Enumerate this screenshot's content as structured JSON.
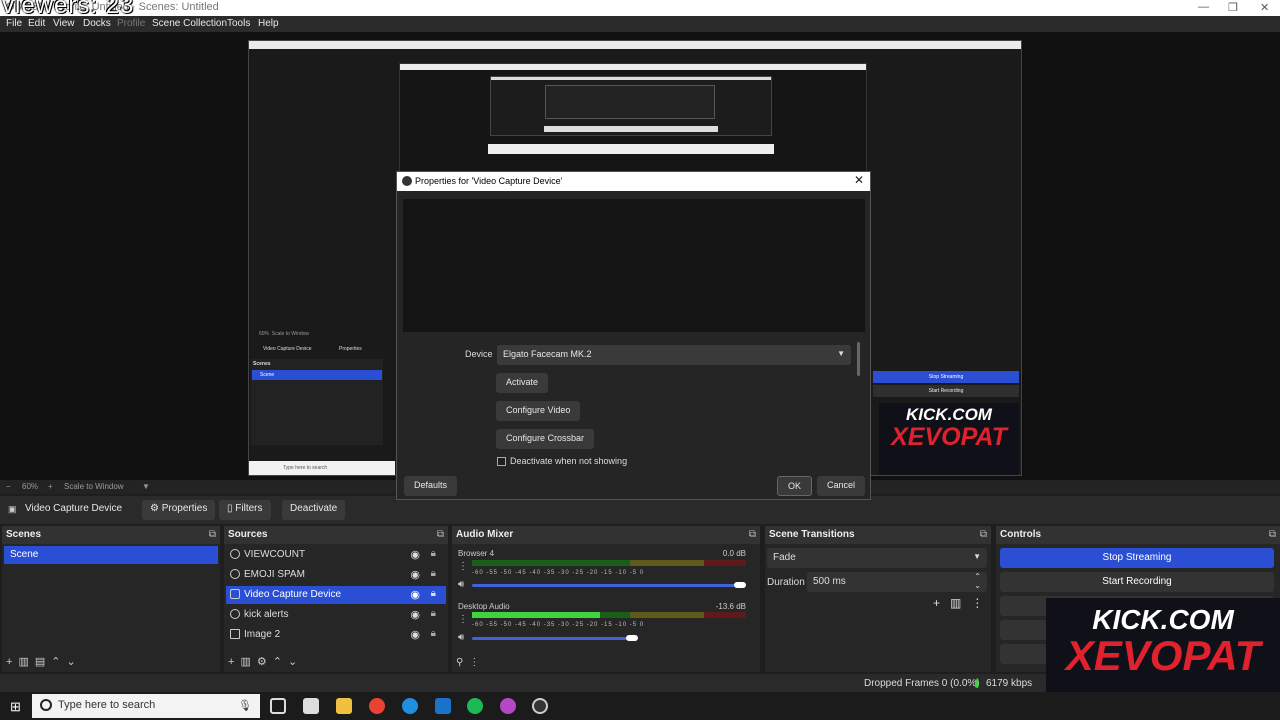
{
  "titlebar": {
    "title": "OBS 32 · Profile: Untitled · Scenes: Untitled",
    "overlay": "viewers: 23"
  },
  "menu": {
    "items": [
      "File",
      "Edit",
      "View",
      "Docks",
      "Profile",
      "Scene Collection",
      "Tools",
      "Help"
    ]
  },
  "zoombar": {
    "zoom": "60%",
    "scale": "Scale to Window"
  },
  "context": {
    "source": "Video Capture Device",
    "properties": "Properties",
    "filters": "Filters",
    "deactivate": "Deactivate"
  },
  "scenes": {
    "title": "Scenes",
    "items": [
      "Scene"
    ]
  },
  "sources": {
    "title": "Sources",
    "items": [
      "VIEWCOUNT",
      "EMOJI SPAM",
      "Video Capture Device",
      "kick alerts",
      "Image 2"
    ]
  },
  "mixer": {
    "title": "Audio Mixer",
    "channels": [
      {
        "name": "Browser 4",
        "db": "0.0 dB",
        "level": 0.0
      },
      {
        "name": "Desktop Audio",
        "db": "-13.6 dB",
        "level": 0.45
      }
    ],
    "scale": "-60 -55 -50 -45 -40 -35 -30 -25 -20 -15 -10 -5 0"
  },
  "transitions": {
    "title": "Scene Transitions",
    "selected": "Fade",
    "duration_label": "Duration",
    "duration": "500 ms"
  },
  "controls": {
    "title": "Controls",
    "stop_streaming": "Stop Streaming",
    "start_recording": "Start Recording"
  },
  "status": {
    "dropped": "Dropped Frames 0 (0.0%)",
    "bitrate": "6179 kbps"
  },
  "taskbar": {
    "search_placeholder": "Type here to search"
  },
  "dialog": {
    "title": "Properties for 'Video Capture Device'",
    "device_label": "Device",
    "device_value": "Elgato Facecam MK.2",
    "activate": "Activate",
    "configure_video": "Configure Video",
    "configure_crossbar": "Configure Crossbar",
    "deactivate_checkbox": "Deactivate when not showing",
    "defaults": "Defaults",
    "ok": "OK",
    "cancel": "Cancel"
  },
  "nested": {
    "scenes": "Scenes",
    "scene": "Scene",
    "source": "Video Capture Device",
    "properties": "Properties",
    "zoom": "60%",
    "scale": "Scale to Window",
    "stop": "Stop Streaming",
    "start": "Start Recording",
    "search": "Type here to search"
  },
  "overlay_logo": {
    "line1": "KICK.COM",
    "line2": "XEVOPAT"
  },
  "colors": {
    "accent": "#2a4fd4",
    "brand_red": "#e0212e"
  }
}
